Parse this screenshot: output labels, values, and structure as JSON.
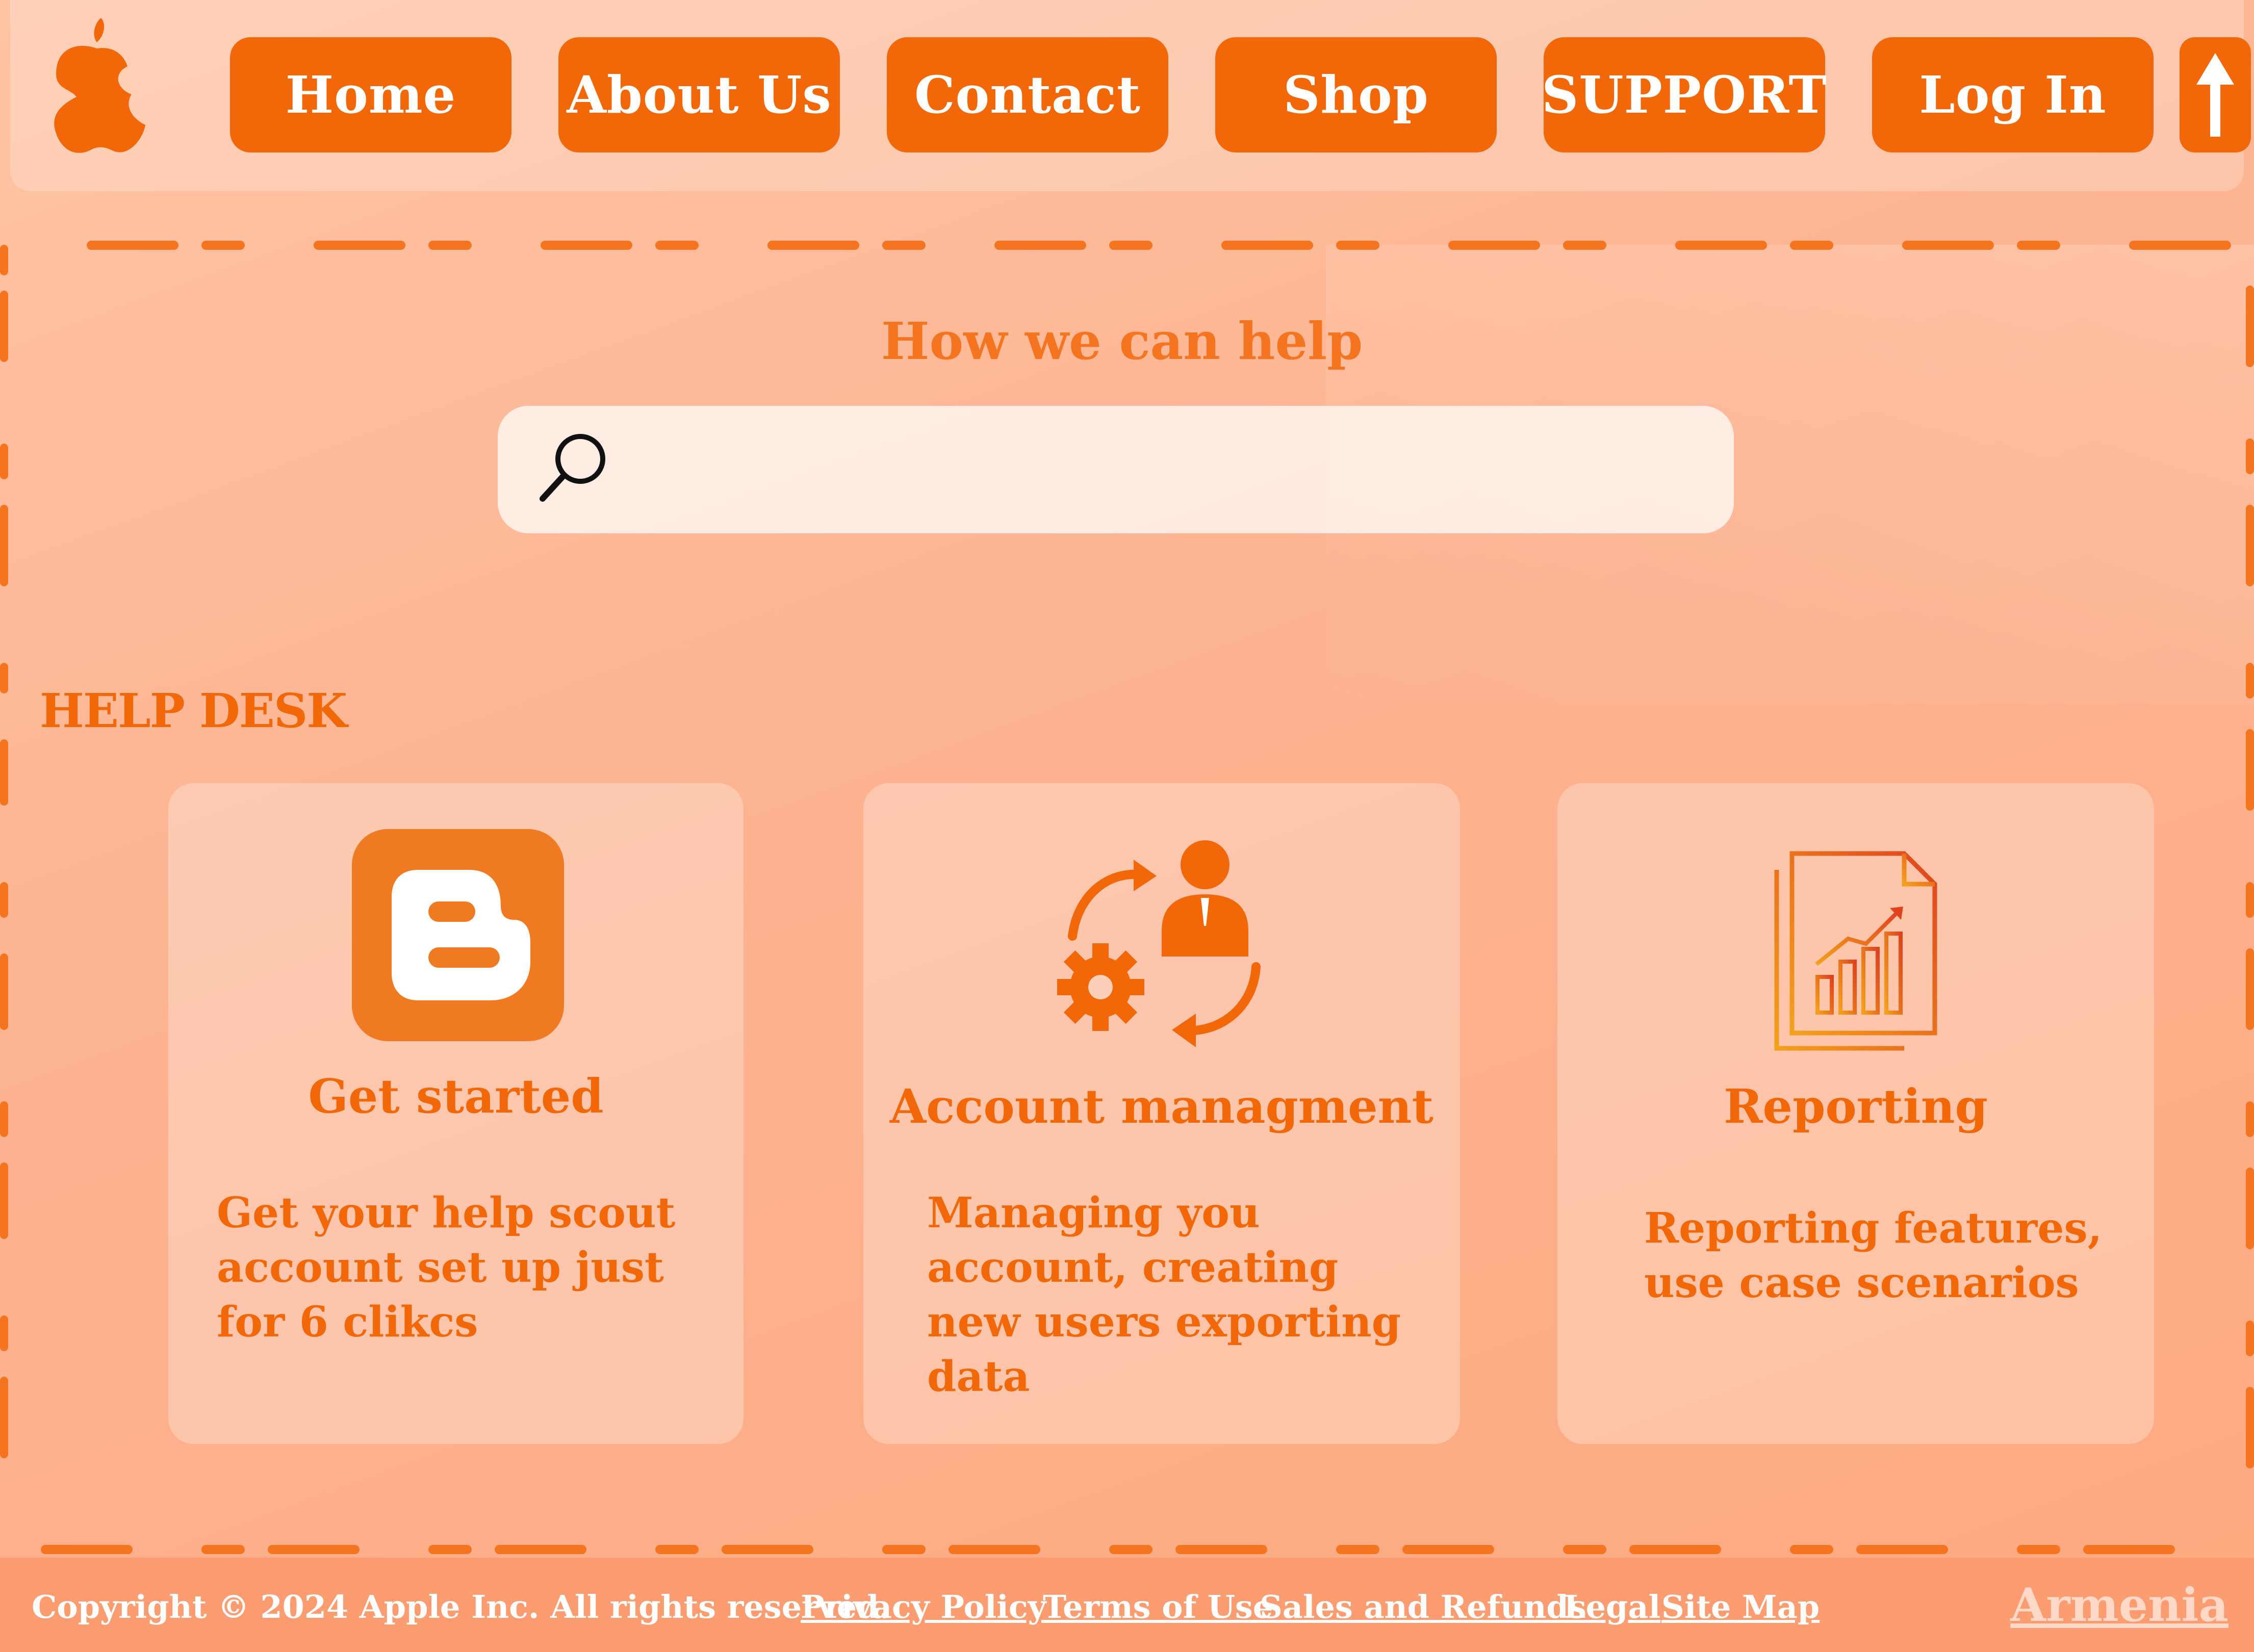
{
  "nav": {
    "logo_icon": "apple-logo-icon",
    "items": [
      "Home",
      "About Us",
      "Contact",
      "Shop",
      "SUPPORT",
      "Log In"
    ],
    "scroll_top_icon": "arrow-up-icon"
  },
  "hero": {
    "title": "How we can help",
    "search_icon": "search-icon",
    "search_placeholder": ""
  },
  "help_desk": {
    "title": "HELP DESK",
    "cards": [
      {
        "icon": "blogger-icon",
        "title": "Get started",
        "text": "Get your help scout account set up just for 6 clikcs"
      },
      {
        "icon": "account-management-icon",
        "title": "Account managment",
        "text": "Managing you account, creating new users exporting data"
      },
      {
        "icon": "report-chart-icon",
        "title": "Reporting",
        "text": "Reporting features, use case scenarios"
      }
    ]
  },
  "footer": {
    "copyright": "Copyright © 2024 Apple Inc. All rights reserved.",
    "links": [
      "Privacy Policy",
      "Terms of Use",
      "Sales and Refunds",
      "Legal",
      "Site Map"
    ],
    "region": "Armenia"
  },
  "colors": {
    "accent": "#f26808",
    "background": "#fdb390",
    "footer": "#fb9d70"
  }
}
